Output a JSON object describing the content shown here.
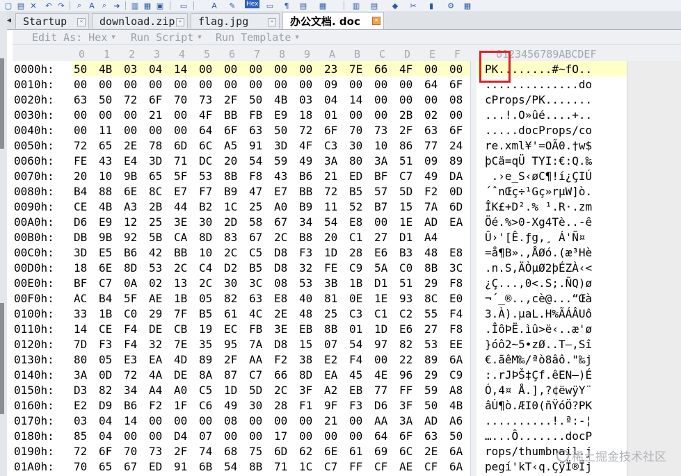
{
  "toolbar": {
    "hex_label": "Hex"
  },
  "tabs": [
    {
      "label": "Startup",
      "active": false
    },
    {
      "label": "download.zip",
      "active": false
    },
    {
      "label": "flag.jpg",
      "active": false
    },
    {
      "label": "办公文档. doc",
      "active": true
    }
  ],
  "editbar": {
    "edit_as": "Edit As: Hex",
    "run_script": "Run Script",
    "run_template": "Run Template"
  },
  "column_header": {
    "hex_cols": [
      "0",
      "1",
      "2",
      "3",
      "4",
      "5",
      "6",
      "7",
      "8",
      "9",
      "A",
      "B",
      "C",
      "D",
      "E",
      "F"
    ],
    "text_cols": "0123456789ABCDEF"
  },
  "rows": [
    {
      "addr": "0000h:",
      "hex": [
        "50",
        "4B",
        "03",
        "04",
        "14",
        "00",
        "00",
        "00",
        "00",
        "00",
        "23",
        "7E",
        "66",
        "4F",
        "00",
        "00"
      ],
      "text": "PK........#~fO.."
    },
    {
      "addr": "0010h:",
      "hex": [
        "00",
        "00",
        "00",
        "00",
        "00",
        "00",
        "00",
        "00",
        "00",
        "00",
        "09",
        "00",
        "00",
        "00",
        "64",
        "6F"
      ],
      "text": "..............do"
    },
    {
      "addr": "0020h:",
      "hex": [
        "63",
        "50",
        "72",
        "6F",
        "70",
        "73",
        "2F",
        "50",
        "4B",
        "03",
        "04",
        "14",
        "00",
        "00",
        "00",
        "08"
      ],
      "text": "cProps/PK......."
    },
    {
      "addr": "0030h:",
      "hex": [
        "00",
        "00",
        "00",
        "21",
        "00",
        "4F",
        "BB",
        "FB",
        "E9",
        "18",
        "01",
        "00",
        "00",
        "2B",
        "02",
        "00"
      ],
      "text": "...!.O»ûé....+.."
    },
    {
      "addr": "0040h:",
      "hex": [
        "00",
        "11",
        "00",
        "00",
        "00",
        "64",
        "6F",
        "63",
        "50",
        "72",
        "6F",
        "70",
        "73",
        "2F",
        "63",
        "6F"
      ],
      "text": ".....docProps/co"
    },
    {
      "addr": "0050h:",
      "hex": [
        "72",
        "65",
        "2E",
        "78",
        "6D",
        "6C",
        "A5",
        "91",
        "3D",
        "4F",
        "C3",
        "30",
        "10",
        "86",
        "77",
        "24"
      ],
      "text": "re.xml¥'=OÃ0.†w$"
    },
    {
      "addr": "0060h:",
      "hex": [
        "FE",
        "43",
        "E4",
        "3D",
        "71",
        "DC",
        "20",
        "54",
        "59",
        "49",
        "3A",
        "80",
        "3A",
        "51",
        "09",
        "89"
      ],
      "text": "þCä=qÜ TYI:€:Q.‰"
    },
    {
      "addr": "0070h:",
      "hex": [
        "20",
        "10",
        "9B",
        "65",
        "5F",
        "53",
        "8B",
        "F8",
        "43",
        "B6",
        "21",
        "ED",
        "BF",
        "C7",
        "49",
        "DA"
      ],
      "text": " .›e_S‹øC¶!í¿ÇIÚ"
    },
    {
      "addr": "0080h:",
      "hex": [
        "B4",
        "88",
        "6E",
        "8C",
        "E7",
        "F7",
        "B9",
        "47",
        "E7",
        "BB",
        "72",
        "B5",
        "57",
        "5D",
        "F2",
        "0D"
      ],
      "text": "´ˆnŒç÷¹Gç»rµW]ò."
    },
    {
      "addr": "0090h:",
      "hex": [
        "CE",
        "4B",
        "A3",
        "2B",
        "44",
        "B2",
        "1C",
        "25",
        "A0",
        "B9",
        "11",
        "52",
        "B7",
        "15",
        "7A",
        "6D"
      ],
      "text": "ÎK£+D².% ¹.R·.zm"
    },
    {
      "addr": "00A0h:",
      "hex": [
        "D6",
        "E9",
        "12",
        "25",
        "3E",
        "30",
        "2D",
        "58",
        "67",
        "34",
        "54",
        "E8",
        "00",
        "1E",
        "AD",
        "EA"
      ],
      "text": "Öé.%>0-Xg4Tè..-ê"
    },
    {
      "addr": "00B0h:",
      "hex": [
        "DB",
        "9B",
        "92",
        "5B",
        "CA",
        "8D",
        "83",
        "67",
        "2C",
        "B8",
        "20",
        "C1",
        "27",
        "D1",
        "A4"
      ],
      "text": "Û›'[Ê.ƒg,¸ Á'Ñ¤"
    },
    {
      "addr": "00C0h:",
      "hex": [
        "3D",
        "E5",
        "B6",
        "42",
        "BB",
        "10",
        "2C",
        "C5",
        "D8",
        "F3",
        "1D",
        "28",
        "E6",
        "B3",
        "48",
        "E8"
      ],
      "text": "=å¶B».,ÅØó.(æ³Hè"
    },
    {
      "addr": "00D0h:",
      "hex": [
        "18",
        "6E",
        "8D",
        "53",
        "2C",
        "C4",
        "D2",
        "B5",
        "D8",
        "32",
        "FE",
        "C9",
        "5A",
        "C0",
        "8B",
        "3C"
      ],
      "text": ".n.S,ÄÒµØ2þÉZÀ‹<"
    },
    {
      "addr": "00E0h:",
      "hex": [
        "BF",
        "C7",
        "0A",
        "02",
        "13",
        "2C",
        "30",
        "3C",
        "08",
        "53",
        "3B",
        "1B",
        "D1",
        "51",
        "29",
        "F8"
      ],
      "text": "¿Ç...,0<.S;.ÑQ)ø"
    },
    {
      "addr": "00F0h:",
      "hex": [
        "AC",
        "B4",
        "5F",
        "AE",
        "1B",
        "05",
        "82",
        "63",
        "E8",
        "40",
        "81",
        "0E",
        "1E",
        "93",
        "8C",
        "E0"
      ],
      "text": "¬´_®..‚cè@...“Œà"
    },
    {
      "addr": "0100h:",
      "hex": [
        "33",
        "1B",
        "C0",
        "29",
        "7F",
        "B5",
        "61",
        "4C",
        "2E",
        "48",
        "25",
        "C3",
        "C1",
        "C2",
        "55",
        "F4"
      ],
      "text": "3.À).µaL.H%ÃÁÂUô"
    },
    {
      "addr": "0110h:",
      "hex": [
        "14",
        "CE",
        "F4",
        "DE",
        "CB",
        "19",
        "EC",
        "FB",
        "3E",
        "EB",
        "8B",
        "01",
        "1D",
        "E6",
        "27",
        "F8"
      ],
      "text": ".ÎôÞË.ìû>ë‹..æ'ø"
    },
    {
      "addr": "0120h:",
      "hex": [
        "7D",
        "F3",
        "F4",
        "32",
        "7E",
        "35",
        "95",
        "7A",
        "D8",
        "15",
        "07",
        "54",
        "97",
        "82",
        "53",
        "EE"
      ],
      "text": "}óô2~5•zØ..T—‚Sî"
    },
    {
      "addr": "0130h:",
      "hex": [
        "80",
        "05",
        "E3",
        "EA",
        "4D",
        "89",
        "2F",
        "AA",
        "F2",
        "38",
        "E2",
        "F4",
        "00",
        "22",
        "89",
        "6A"
      ],
      "text": "€.ãêM‰/ªò8âô.\"‰j"
    },
    {
      "addr": "0140h:",
      "hex": [
        "3A",
        "0D",
        "72",
        "4A",
        "DE",
        "8A",
        "87",
        "C7",
        "66",
        "8D",
        "EA",
        "45",
        "4E",
        "96",
        "29",
        "C9"
      ],
      "text": ":.rJÞŠ‡Çf.êEN–)É"
    },
    {
      "addr": "0150h:",
      "hex": [
        "D3",
        "82",
        "34",
        "A4",
        "A0",
        "C5",
        "1D",
        "5D",
        "2C",
        "3F",
        "A2",
        "EB",
        "77",
        "FF",
        "59",
        "A8"
      ],
      "text": "Ó‚4¤ Å.],?¢ëwÿY¨"
    },
    {
      "addr": "0160h:",
      "hex": [
        "E2",
        "D9",
        "B6",
        "F2",
        "1F",
        "C6",
        "49",
        "30",
        "28",
        "F1",
        "9F",
        "F3",
        "D6",
        "3F",
        "50",
        "4B"
      ],
      "text": "âÙ¶ò.ÆI0(ñŸóÖ?PK"
    },
    {
      "addr": "0170h:",
      "hex": [
        "03",
        "04",
        "14",
        "00",
        "00",
        "00",
        "08",
        "00",
        "00",
        "00",
        "21",
        "00",
        "AA",
        "3A",
        "AD",
        "A6"
      ],
      "text": "..........!.ª:-¦"
    },
    {
      "addr": "0180h:",
      "hex": [
        "85",
        "04",
        "00",
        "00",
        "D4",
        "07",
        "00",
        "00",
        "17",
        "00",
        "00",
        "00",
        "64",
        "6F",
        "63",
        "50"
      ],
      "text": "…...Ô.......docP"
    },
    {
      "addr": "0190h:",
      "hex": [
        "72",
        "6F",
        "70",
        "73",
        "2F",
        "74",
        "68",
        "75",
        "6D",
        "62",
        "6E",
        "61",
        "69",
        "6C",
        "2E",
        "6A"
      ],
      "text": "rops/thumbnail.j"
    },
    {
      "addr": "01A0h:",
      "hex": [
        "70",
        "65",
        "67",
        "ED",
        "91",
        "6B",
        "54",
        "8B",
        "71",
        "1C",
        "C7",
        "FF",
        "CF",
        "AE",
        "CF",
        "6A"
      ],
      "text": "pegí'kT‹q.ÇÿÏ®Ïj"
    }
  ],
  "watermark": "稀土掘金技术社区",
  "colors": {
    "highlight_row": "#ffffc8",
    "marker": "#e02020",
    "active_tab_close": "#f0a050"
  }
}
